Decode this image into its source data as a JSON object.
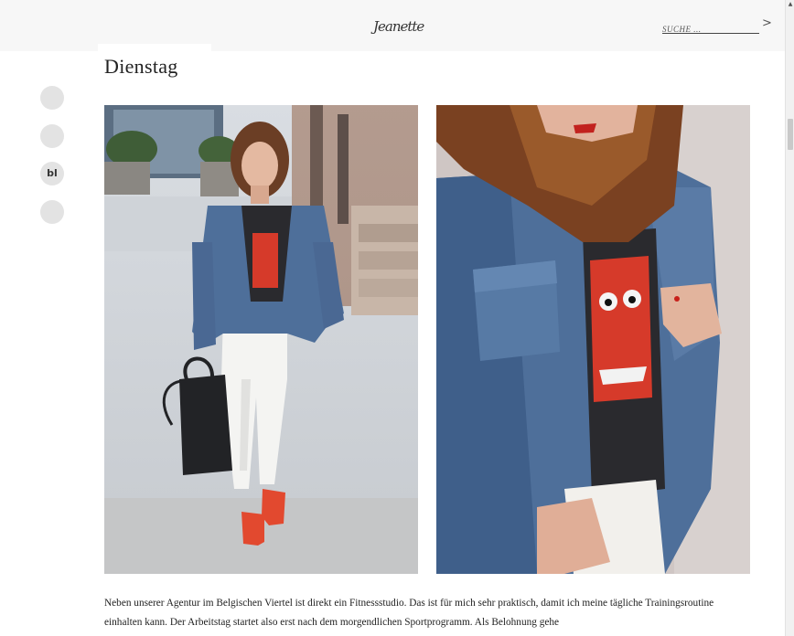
{
  "header": {
    "logo_text": "Jeanette",
    "search": {
      "placeholder": "SUCHE ...",
      "value": ""
    },
    "search_arrow": ">"
  },
  "social": {
    "icons": [
      "circle-icon",
      "circle-icon",
      "bloglovin-icon",
      "circle-icon"
    ],
    "bloglovin_glyph": "bl"
  },
  "post": {
    "title": "Dienstag",
    "images": [
      {
        "subject": "full-outfit-photo",
        "alt": ""
      },
      {
        "subject": "detail-photo",
        "alt": ""
      }
    ],
    "body_text": "Neben unserer Agentur im Belgischen Viertel ist direkt ein Fitnessstudio. Das ist für mich sehr praktisch, damit ich meine tägliche Trainingsroutine einhalten kann. Der Arbeitstag startet also erst nach dem morgendlichen Sportprogramm. Als Belohnung gehe"
  },
  "colors": {
    "header_bg": "#f7f7f7",
    "denim": "#4e6f9a",
    "shoes": "#e2492f",
    "sweater_red": "#d63a2a"
  },
  "scrollbar": {
    "up_glyph": "▲"
  }
}
